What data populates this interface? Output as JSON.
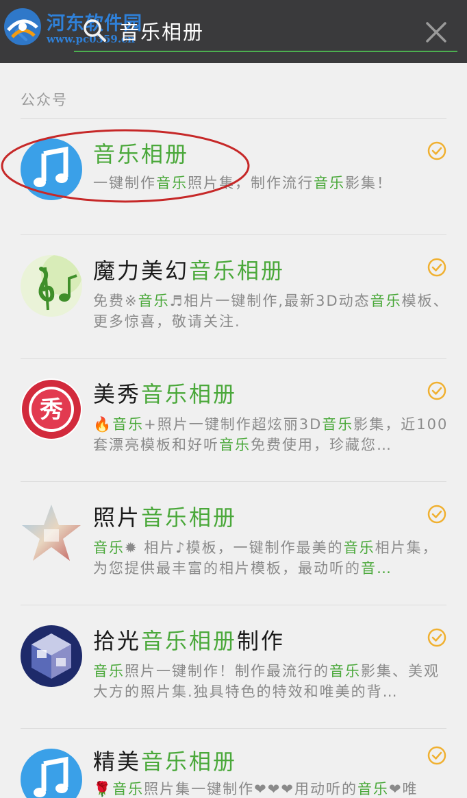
{
  "watermark": {
    "title": "河东软件园",
    "url": "www.pc0359.cn"
  },
  "search": {
    "query": "音乐相册"
  },
  "section": {
    "title": "公众号"
  },
  "colors": {
    "topbar": "#3a3a3c",
    "accent": "#4aa83a",
    "verified": "#f0b030",
    "highlight_ring": "#c62828"
  },
  "accounts": [
    {
      "title_plain": "",
      "title_hl": "音乐相册",
      "title_after": "",
      "desc_line1": "一键制作音乐照片集，制作流行音乐影集！",
      "desc_line2": "",
      "desc_segments": [
        [
          "一键制作",
          false
        ],
        [
          "音乐",
          true
        ],
        [
          "照片集，制作流行",
          false
        ],
        [
          "音乐",
          true
        ],
        [
          "影集！",
          false
        ]
      ],
      "avatar": "music-note-icon"
    },
    {
      "title_plain": "魔力美幻",
      "title_hl": "音乐相册",
      "title_after": "",
      "desc_segments": [
        [
          "免费※",
          false
        ],
        [
          "音乐",
          true
        ],
        [
          "♬相片一键制作,最新3D动态",
          false
        ],
        [
          "音乐",
          true
        ],
        [
          "模板、更多惊喜，敬请关注.",
          false
        ]
      ],
      "avatar": "treble-clef-icon"
    },
    {
      "title_plain": "美秀",
      "title_hl": "音乐相册",
      "title_after": "",
      "desc_segments": [
        [
          "🔥",
          false
        ],
        [
          "音乐",
          true
        ],
        [
          "+照片一键制作超炫丽3D",
          false
        ],
        [
          "音乐",
          true
        ],
        [
          "影集，近100套漂亮模板和好听",
          false
        ],
        [
          "音乐",
          true
        ],
        [
          "免费使用，珍藏您…",
          false
        ]
      ],
      "avatar": "xiu-badge-icon",
      "avatar_text": "秀"
    },
    {
      "title_plain": "照片",
      "title_hl": "音乐相册",
      "title_after": "",
      "desc_segments": [
        [
          "音乐",
          true
        ],
        [
          "✹ 相片♪模板，一键制作最美的",
          false
        ],
        [
          "音乐",
          true
        ],
        [
          "相片集，为您提供最丰富的相片模板，最动听的",
          false
        ],
        [
          "音…",
          true
        ]
      ],
      "avatar": "photo-star-icon"
    },
    {
      "title_plain": "拾光",
      "title_hl": "音乐相册",
      "title_after": "制作",
      "desc_segments": [
        [
          "音乐",
          true
        ],
        [
          "照片一键制作！制作最流行的",
          false
        ],
        [
          "音乐",
          true
        ],
        [
          "影集、美观大方的照片集.独具特色的特效和唯美的背…",
          false
        ]
      ],
      "avatar": "photo-cube-icon"
    },
    {
      "title_plain": "精美",
      "title_hl": "音乐相册",
      "title_after": "",
      "desc_segments": [
        [
          "🌹",
          false
        ],
        [
          "音乐",
          true
        ],
        [
          "照片集一键制作❤❤❤用动听的",
          false
        ],
        [
          "音乐",
          true
        ],
        [
          "❤唯",
          false
        ]
      ],
      "avatar": "music-note-icon"
    }
  ]
}
